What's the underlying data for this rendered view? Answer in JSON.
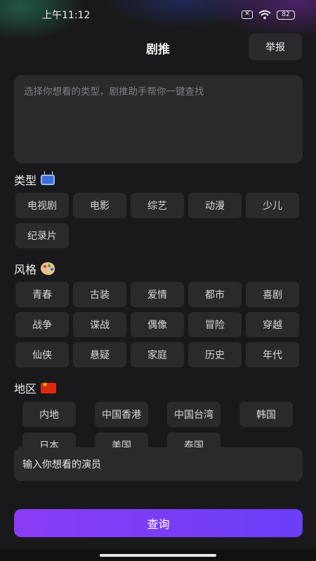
{
  "status_bar": {
    "time": "上午11:12",
    "battery": "82",
    "sim": "✕"
  },
  "header": {
    "title": "剧推",
    "report_label": "举报"
  },
  "prompt": {
    "placeholder": "选择你想看的类型，剧推助手帮你一键查找"
  },
  "sections": {
    "type": {
      "title": "类型",
      "icon": "tv-icon",
      "chips": [
        "电视剧",
        "电影",
        "综艺",
        "动漫",
        "少儿",
        "纪录片"
      ]
    },
    "style": {
      "title": "风格",
      "icon": "palette-icon",
      "chips": [
        "青春",
        "古装",
        "爱情",
        "都市",
        "喜剧",
        "战争",
        "谍战",
        "偶像",
        "冒险",
        "穿越",
        "仙侠",
        "悬疑",
        "家庭",
        "历史",
        "年代"
      ]
    },
    "region": {
      "title": "地区",
      "icon": "china-flag-icon",
      "chips": [
        "内地",
        "中国香港",
        "中国台湾",
        "韩国",
        "日本",
        "美国",
        "泰国"
      ]
    }
  },
  "actor_input": {
    "placeholder": "输入你想看的演员"
  },
  "search_button": {
    "label": "查询"
  },
  "colors": {
    "accent_start": "#8a3cf5",
    "accent_end": "#6b3ef8",
    "background": "#19191b",
    "chip": "#2a2a2d"
  }
}
